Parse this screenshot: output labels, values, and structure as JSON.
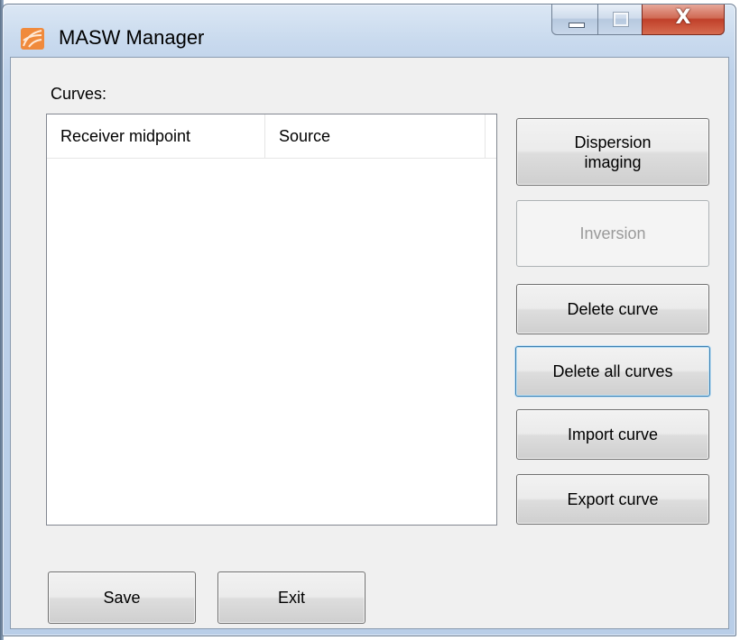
{
  "window": {
    "title": "MASW Manager",
    "icon": "masw-app-icon",
    "caption_buttons": {
      "minimize_icon": "minimize-icon",
      "maximize_icon": "maximize-icon",
      "close_label": "X"
    }
  },
  "curves": {
    "label": "Curves:",
    "columns": [
      "Receiver midpoint",
      "Source"
    ],
    "rows": []
  },
  "side_buttons": {
    "dispersion_line1": "Dispersion",
    "dispersion_line2": "imaging",
    "inversion": "Inversion",
    "inversion_enabled": false,
    "delete_curve": "Delete curve",
    "delete_all_curves": "Delete all curves",
    "import_curve": "Import curve",
    "export_curve": "Export curve"
  },
  "footer_buttons": {
    "save": "Save",
    "exit": "Exit"
  },
  "colors": {
    "accent_focus": "#3c7fb1",
    "close_button": "#c0402a",
    "app_icon": "#f08a3c"
  }
}
